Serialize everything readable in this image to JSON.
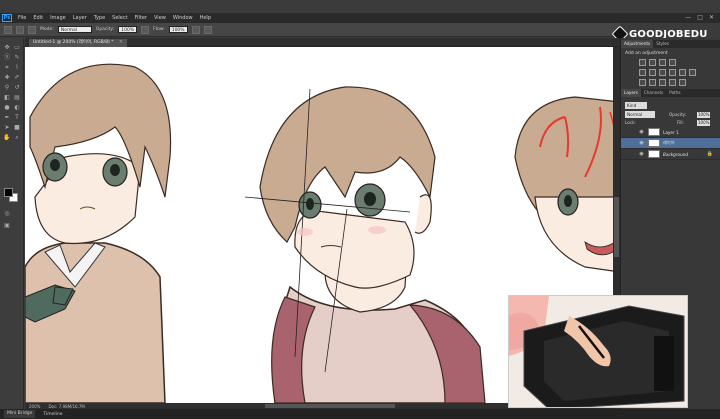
{
  "app": {
    "logo": "Ps"
  },
  "menu": [
    "File",
    "Edit",
    "Image",
    "Layer",
    "Type",
    "Select",
    "Filter",
    "View",
    "Window",
    "Help"
  ],
  "window_controls": [
    "—",
    "□",
    "✕"
  ],
  "options": {
    "mode_label": "Mode:",
    "mode_value": "Normal",
    "opacity_label": "Opacity:",
    "opacity_value": "100%",
    "flow_label": "Flow:",
    "flow_value": "100%"
  },
  "brand": {
    "text": "GOODJOBEDU"
  },
  "document": {
    "tab_title": "Untitled-1 @ 200% (레이어, RGB/8) *",
    "zoom": "200%",
    "doc_info": "Doc: 7.98M/16.7M"
  },
  "bottom_tabs": [
    "Mini Bridge",
    "Timeline"
  ],
  "panels": {
    "adj_tabs": [
      "Adjustments",
      "Styles"
    ],
    "adj_title": "Add an adjustment",
    "layer_tabs": [
      "Layers",
      "Channels",
      "Paths"
    ],
    "filter_kind": "Kind",
    "blend_mode": "Normal",
    "opacity_label": "Opacity:",
    "opacity_value": "100%",
    "lock_label": "Lock:",
    "fill_label": "Fill:",
    "fill_value": "100%",
    "layers": [
      {
        "name": "Layer 1",
        "selected": false
      },
      {
        "name": "레이어",
        "selected": true
      },
      {
        "name": "Background",
        "selected": false
      }
    ]
  },
  "colors": {
    "ui_dark": "#3b3b3b",
    "selected_layer": "#4f6f98",
    "sketch_red": "#e53a2c",
    "hair": "#c9ab92",
    "skin": "#fbece2"
  }
}
